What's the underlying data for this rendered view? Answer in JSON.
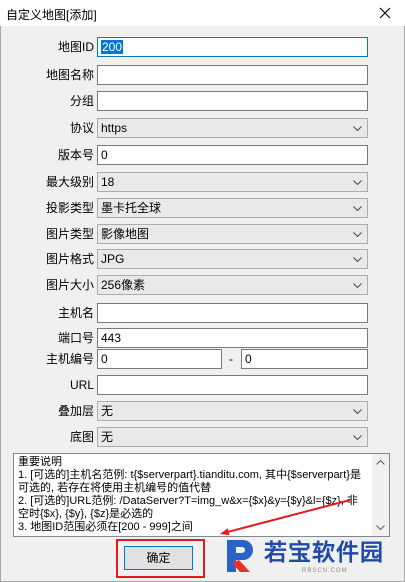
{
  "window": {
    "title": "自定义地图[添加]"
  },
  "form": {
    "map_id": {
      "label": "地图ID",
      "value": "200"
    },
    "map_name": {
      "label": "地图名称",
      "value": ""
    },
    "group": {
      "label": "分组",
      "value": ""
    },
    "protocol": {
      "label": "协议",
      "value": "https"
    },
    "version": {
      "label": "版本号",
      "value": "0"
    },
    "max_level": {
      "label": "最大级别",
      "value": "18"
    },
    "projection": {
      "label": "投影类型",
      "value": "墨卡托全球"
    },
    "image_type": {
      "label": "图片类型",
      "value": "影像地图"
    },
    "image_format": {
      "label": "图片格式",
      "value": "JPG"
    },
    "image_size": {
      "label": "图片大小",
      "value": "256像素"
    },
    "host": {
      "label": "主机名",
      "value": ""
    },
    "port": {
      "label": "端口号",
      "value": "443"
    },
    "host_number": {
      "label": "主机编号",
      "from": "0",
      "separator": "-",
      "to": "0"
    },
    "url": {
      "label": "URL",
      "value": ""
    },
    "overlay": {
      "label": "叠加层",
      "value": "无"
    },
    "base_map": {
      "label": "底图",
      "value": "无"
    }
  },
  "notes": {
    "heading": "重要说明",
    "items": [
      "1. [可选的]主机名范例: t{$serverpart}.tianditu.com, 其中{$serverpart}是可选的, 若存在将使用主机编号的值代替",
      "2. [可选的]URL范例: /DataServer?T=img_w&x={$x}&y={$y}&l={$z}, 非空时{$x}, {$y}, {$z}是必选的",
      "3. 地图ID范围必须在[200 - 999]之间"
    ]
  },
  "buttons": {
    "confirm": "确定"
  },
  "watermark": {
    "name": "若宝软件园",
    "url": "RBSCN.COM"
  },
  "icons": {
    "close": "close-icon",
    "dropdown": "chevron-down-icon",
    "scroll_up": "scroll-up-arrow-icon",
    "scroll_down": "scroll-down-arrow-icon",
    "logo": "r-logo-icon"
  },
  "colors": {
    "focus_border": "#0078d7",
    "selection": "#0078d7",
    "annotation": "#e31b23",
    "watermark_blue": "#1f4aa8",
    "watermark_red": "#e5322d"
  }
}
